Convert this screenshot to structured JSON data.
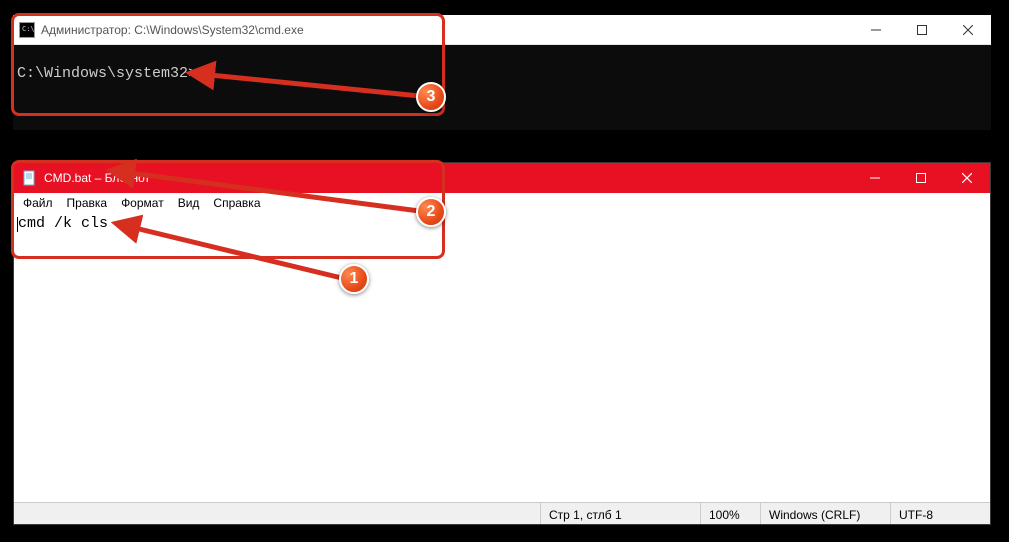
{
  "cmd": {
    "title": "Администратор: C:\\Windows\\System32\\cmd.exe",
    "prompt": "C:\\Windows\\system32>"
  },
  "notepad": {
    "title": "CMD.bat – Блокнот",
    "menu": {
      "file": "Файл",
      "edit": "Правка",
      "format": "Формат",
      "view": "Вид",
      "help": "Справка"
    },
    "content": "cmd /k cls",
    "status": {
      "position": "Стр 1, стлб 1",
      "zoom": "100%",
      "encoding_mode": "Windows (CRLF)",
      "encoding": "UTF-8"
    }
  },
  "badges": {
    "b1": "1",
    "b2": "2",
    "b3": "3"
  }
}
